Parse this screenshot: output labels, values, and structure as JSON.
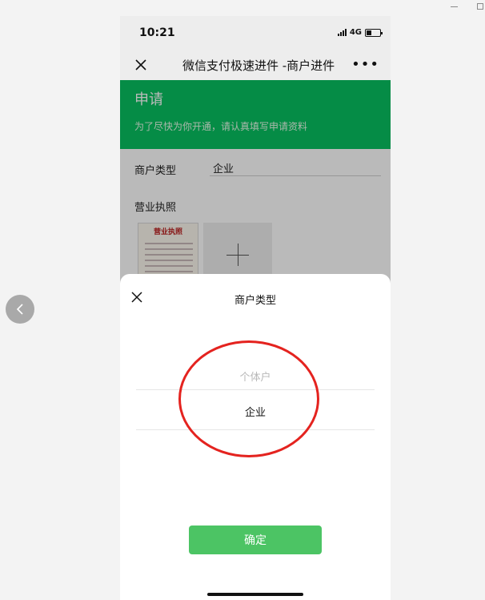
{
  "status_bar": {
    "time": "10:21",
    "network": "4G",
    "battery_level": 0.35
  },
  "nav": {
    "title": "微信支付极速进件 -商户进件"
  },
  "banner": {
    "title": "申请",
    "subtitle": "为了尽快为你开通，请认真填写申请资料"
  },
  "form": {
    "merchant_type_label": "商户类型",
    "merchant_type_value": "企业",
    "license_label": "营业执照",
    "license_thumb_text": "营业执照"
  },
  "sheet": {
    "title": "商户类型",
    "options": [
      "个体户",
      "企业"
    ],
    "selected": "企业",
    "confirm_label": "确定"
  },
  "colors": {
    "brand_green": "#07c160",
    "button_green": "#4cc464",
    "annotation_red": "#e4231f"
  }
}
